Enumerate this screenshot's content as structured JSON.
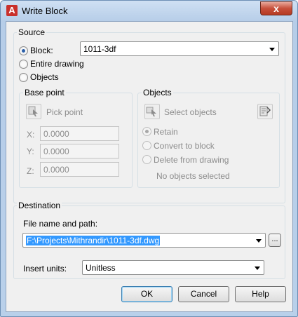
{
  "window": {
    "title": "Write Block",
    "close_glyph": "x"
  },
  "source": {
    "group_label": "Source",
    "block_label": "Block:",
    "block_value": "1011-3df",
    "entire_drawing_label": "Entire drawing",
    "objects_label": "Objects",
    "selected": "block"
  },
  "base_point": {
    "group_label": "Base point",
    "pick_point_label": "Pick point",
    "x_label": "X:",
    "x_value": "0.0000",
    "y_label": "Y:",
    "y_value": "0.0000",
    "z_label": "Z:",
    "z_value": "0.0000"
  },
  "objects": {
    "group_label": "Objects",
    "select_objects_label": "Select objects",
    "retain_label": "Retain",
    "convert_label": "Convert to block",
    "delete_label": "Delete from drawing",
    "status": "No objects selected"
  },
  "destination": {
    "group_label": "Destination",
    "file_label": "File name and path:",
    "file_value": "F:\\Projects\\Mithrandir\\1011-3df.dwg",
    "browse_label": "...",
    "units_label": "Insert units:",
    "units_value": "Unitless"
  },
  "buttons": {
    "ok": "OK",
    "cancel": "Cancel",
    "help": "Help"
  },
  "icons": {
    "app": "autocad-app-icon",
    "pick_point": "pick-point-icon",
    "select_objects": "select-objects-icon",
    "quick_select": "quick-select-icon"
  }
}
